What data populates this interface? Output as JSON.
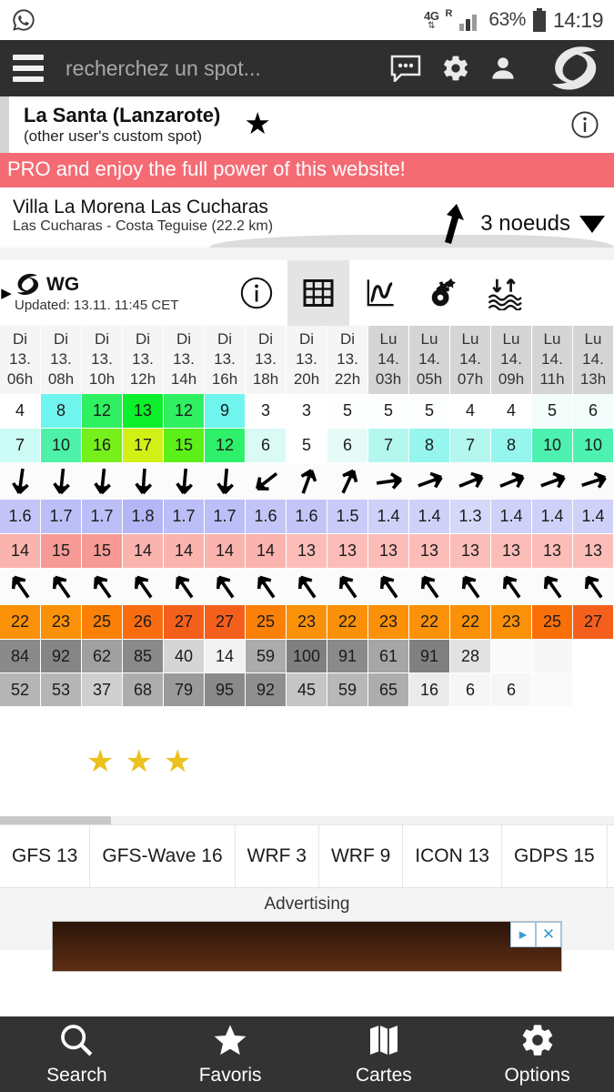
{
  "status_bar": {
    "left_icon": "whatsapp-icon",
    "network_type": "4G",
    "roaming": "R",
    "battery": "63%",
    "clock": "14:19"
  },
  "app_bar": {
    "menu_icon": "hamburger-icon",
    "search_placeholder": "recherchez un spot...",
    "icons": [
      "chat-icon",
      "gear-icon",
      "user-icon",
      "windguru-logo-icon"
    ]
  },
  "spot_header": {
    "name": "La Santa (Lanzarote)",
    "subtitle": "(other user's custom spot)",
    "star_icon": "star-icon",
    "info_icon": "info-icon"
  },
  "pro_banner": {
    "text": "PRO and enjoy the full power of this website!",
    "color": "#f46b74"
  },
  "sub_spot": {
    "name": "Villa La Morena Las Cucharas",
    "subtitle": "Las Cucharas - Costa Teguise  (22.2 km)",
    "tide_arrow_icon": "tide-arrow-up-icon",
    "tide_value": "3 noeuds",
    "caret_icon": "chevron-down-icon"
  },
  "model_bar": {
    "expand_icon": "triangle-right-icon",
    "brand_icon": "windguru-logo-icon",
    "brand": "WG",
    "updated": "Updated: 13.11. 11:45 CET",
    "tools": [
      {
        "name": "info-icon",
        "active": false
      },
      {
        "name": "table-icon",
        "active": true
      },
      {
        "name": "chart-icon",
        "active": false
      },
      {
        "name": "settings-gears-icon",
        "active": false
      },
      {
        "name": "tide-waves-icon",
        "active": false
      }
    ]
  },
  "forecast": {
    "columns": [
      {
        "day": "Di",
        "date": "13.",
        "hour": "06h",
        "group": "sun"
      },
      {
        "day": "Di",
        "date": "13.",
        "hour": "08h",
        "group": "sun"
      },
      {
        "day": "Di",
        "date": "13.",
        "hour": "10h",
        "group": "sun"
      },
      {
        "day": "Di",
        "date": "13.",
        "hour": "12h",
        "group": "sun"
      },
      {
        "day": "Di",
        "date": "13.",
        "hour": "14h",
        "group": "sun"
      },
      {
        "day": "Di",
        "date": "13.",
        "hour": "16h",
        "group": "sun"
      },
      {
        "day": "Di",
        "date": "13.",
        "hour": "18h",
        "group": "sun"
      },
      {
        "day": "Di",
        "date": "13.",
        "hour": "20h",
        "group": "sun"
      },
      {
        "day": "Di",
        "date": "13.",
        "hour": "22h",
        "group": "sun"
      },
      {
        "day": "Lu",
        "date": "14.",
        "hour": "03h",
        "group": "mon"
      },
      {
        "day": "Lu",
        "date": "14.",
        "hour": "05h",
        "group": "mon"
      },
      {
        "day": "Lu",
        "date": "14.",
        "hour": "07h",
        "group": "mon"
      },
      {
        "day": "Lu",
        "date": "14.",
        "hour": "09h",
        "group": "mon"
      },
      {
        "day": "Lu",
        "date": "14.",
        "hour": "11h",
        "group": "mon"
      },
      {
        "day": "Lu",
        "date": "14.",
        "hour": "13h",
        "group": "mon"
      }
    ],
    "rows": [
      {
        "id": "wind-speed",
        "type": "value",
        "values": [
          "4",
          "8",
          "12",
          "13",
          "12",
          "9",
          "3",
          "3",
          "5",
          "5",
          "5",
          "4",
          "4",
          "5",
          "6"
        ],
        "colors": [
          "#ffffff",
          "#6ff5ee",
          "#2ff060",
          "#0bf02b",
          "#2ff060",
          "#6ff5ee",
          "#ffffff",
          "#ffffff",
          "#fcfefe",
          "#fcfefe",
          "#fcfefe",
          "#ffffff",
          "#ffffff",
          "#f3fdfb",
          "#f3fdfb"
        ]
      },
      {
        "id": "wind-gusts",
        "type": "value",
        "values": [
          "7",
          "10",
          "16",
          "17",
          "15",
          "12",
          "6",
          "5",
          "6",
          "7",
          "8",
          "7",
          "8",
          "10",
          "10"
        ],
        "colors": [
          "#ccfaf4",
          "#4df2a8",
          "#75f01a",
          "#d3f016",
          "#5cf019",
          "#2ff06a",
          "#dafaf5",
          "#ffffff",
          "#e6fbf7",
          "#b4f7ef",
          "#96f5ec",
          "#b4f7ef",
          "#96f5ec",
          "#4df2b0",
          "#4df2b0"
        ]
      },
      {
        "id": "wind-direction",
        "type": "arrow",
        "angles": [
          8,
          6,
          6,
          4,
          5,
          5,
          52,
          200,
          205,
          262,
          250,
          248,
          248,
          250,
          252
        ]
      },
      {
        "id": "wave-height",
        "type": "value",
        "values": [
          "1.6",
          "1.7",
          "1.7",
          "1.8",
          "1.7",
          "1.7",
          "1.6",
          "1.6",
          "1.5",
          "1.4",
          "1.4",
          "1.3",
          "1.4",
          "1.4",
          "1.4"
        ],
        "colors": [
          "#c3c5f7",
          "#bcbef7",
          "#bcbef7",
          "#b4b6f6",
          "#bcbef7",
          "#bcbef7",
          "#c3c5f7",
          "#c3c5f7",
          "#c9cbf8",
          "#cfd1f9",
          "#cfd1f9",
          "#d6d8fa",
          "#cfd1f9",
          "#cfd1f9",
          "#cfd1f9"
        ]
      },
      {
        "id": "water-temp",
        "type": "value",
        "values": [
          "14",
          "15",
          "15",
          "14",
          "14",
          "14",
          "14",
          "13",
          "13",
          "13",
          "13",
          "13",
          "13",
          "13",
          "13"
        ],
        "colors": [
          "#fbb3ae",
          "#f79a95",
          "#f79a95",
          "#fbb3ae",
          "#fbb3ae",
          "#fbb3ae",
          "#fbb3ae",
          "#fcbdb9",
          "#fcbdb9",
          "#fcbdb9",
          "#fcbdb9",
          "#fcbdb9",
          "#fcbdb9",
          "#fcbdb9",
          "#fcbdb9"
        ]
      },
      {
        "id": "wave-direction",
        "type": "arrow",
        "angles": [
          145,
          145,
          145,
          145,
          145,
          145,
          145,
          145,
          145,
          145,
          145,
          145,
          145,
          145,
          145
        ]
      },
      {
        "id": "wave-period",
        "type": "value",
        "values": [
          "22",
          "23",
          "25",
          "26",
          "27",
          "27",
          "25",
          "23",
          "22",
          "23",
          "22",
          "22",
          "23",
          "25",
          "27"
        ],
        "colors": [
          "#fb9109",
          "#fb9109",
          "#fa8008",
          "#f96d10",
          "#f55f1c",
          "#f55f1c",
          "#fa8008",
          "#fb9109",
          "#fb9109",
          "#fb9109",
          "#fb9109",
          "#fb9109",
          "#fb9109",
          "#fa7008",
          "#f55f1c"
        ]
      },
      {
        "id": "cloud-cover-high",
        "type": "value",
        "values": [
          "84",
          "92",
          "62",
          "85",
          "40",
          "14",
          "59",
          "100",
          "91",
          "61",
          "91",
          "28",
          "",
          "",
          ""
        ],
        "colors": [
          "#8a8a8a",
          "#858585",
          "#a0a0a0",
          "#8a8a8a",
          "#d5d5d5",
          "#f2f2f2",
          "#ababab",
          "#808080",
          "#8a8a8a",
          "#a6a6a6",
          "#808080",
          "#e2e2e2",
          "#fafafa",
          "#f7f7f7",
          "#ffffff"
        ]
      },
      {
        "id": "cloud-cover-low",
        "type": "value",
        "values": [
          "52",
          "53",
          "37",
          "68",
          "79",
          "95",
          "92",
          "45",
          "59",
          "65",
          "16",
          "6",
          "6",
          "",
          ""
        ],
        "colors": [
          "#b5b5b5",
          "#b5b5b5",
          "#cfcfcf",
          "#adadad",
          "#9a9a9a",
          "#8a8a8a",
          "#8f8f8f",
          "#c5c5c5",
          "#b8b8b8",
          "#adadad",
          "#ebebeb",
          "#f6f6f6",
          "#f6f6f6",
          "#fafafa",
          "#ffffff"
        ]
      }
    ]
  },
  "rating": {
    "stars_filled": 3,
    "star_icon": "star-icon",
    "star_color": "#ecc01d"
  },
  "model_tabs": [
    {
      "label": "GFS 13",
      "active": false
    },
    {
      "label": "GFS-Wave 16",
      "active": false
    },
    {
      "label": "WRF 3",
      "active": false
    },
    {
      "label": "WRF 9",
      "active": false
    },
    {
      "label": "ICON 13",
      "active": false
    },
    {
      "label": "GDPS 15",
      "active": false
    }
  ],
  "advertising": {
    "label": "Advertising",
    "play_icon": "ad-choices-icon",
    "close_icon": "close-icon"
  },
  "bottom_nav": [
    {
      "icon": "search-icon",
      "label": "Search"
    },
    {
      "icon": "star-icon",
      "label": "Favoris"
    },
    {
      "icon": "map-icon",
      "label": "Cartes"
    },
    {
      "icon": "gear-icon",
      "label": "Options"
    }
  ]
}
